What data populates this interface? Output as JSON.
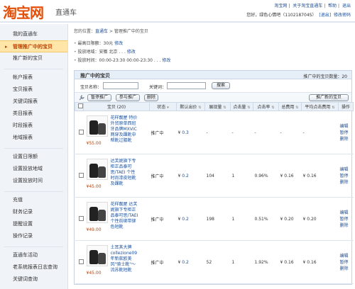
{
  "header": {
    "logo": "淘宝网",
    "logo_sub": "直通车",
    "top_links": [
      "淘宝网",
      "关于淘宝直通车",
      "帮助",
      "退出"
    ],
    "welcome": "您好，绿色心情吧（110218704S）",
    "exit_link": "[退出]",
    "modify_pwd": "修改密码"
  },
  "sidebar": {
    "items": [
      {
        "label": "我的直通车",
        "active": false
      },
      {
        "label": "管理推广中的宝贝",
        "active": true
      },
      {
        "label": "推广新的宝贝",
        "active": false
      },
      {
        "label": "帐户报表",
        "active": false
      },
      {
        "label": "宝贝报表",
        "active": false
      },
      {
        "label": "关键词报表",
        "active": false
      },
      {
        "label": "类目报表",
        "active": false
      },
      {
        "label": "时段报表",
        "active": false
      },
      {
        "label": "地域报表",
        "active": false
      },
      {
        "label": "设置日限额",
        "active": false
      },
      {
        "label": "设置投放地域",
        "active": false
      },
      {
        "label": "设置投放时间",
        "active": false
      },
      {
        "label": "充值",
        "active": false
      },
      {
        "label": "财务记录",
        "active": false
      },
      {
        "label": "提醒设置",
        "active": false
      },
      {
        "label": "操作记录",
        "active": false
      },
      {
        "label": "直通车活动",
        "active": false
      },
      {
        "label": "老系统报表日志查询",
        "active": false
      },
      {
        "label": "关键词查询",
        "active": false
      }
    ]
  },
  "breadcrumb": {
    "prefix": "您的位置：",
    "home": "直通车",
    "sep": " > ",
    "current": "管理推广中的宝贝"
  },
  "info": {
    "daily_limit": "最高日限额：30元",
    "daily_limit_edit": "修改",
    "region": "投放地域：安徽 北京 . . .",
    "region_edit": "修改",
    "time": "投放时间：00:00-23:30 00:00-23:30 . . .",
    "time_edit": "修改"
  },
  "panel": {
    "title": "推广中的宝贝",
    "count": "推广中的宝贝数量：20",
    "search": {
      "name_label": "宝贝名称：",
      "keyword_label": "关键词：",
      "search_button": "搜索"
    },
    "actions": {
      "pause": "暂停推广",
      "join": "参与推广",
      "delete": "删除",
      "promote_new": "推广新的宝贝"
    },
    "columns": [
      "宝贝",
      "状态",
      "默认出价",
      "展现量",
      "点击量",
      "点击率",
      "总费用",
      "平均点击费用",
      "操作"
    ],
    "baby_count_suffix": "(20)",
    "rows": [
      {
        "title": "花样靓屋 特价外贸原单西班牙品牌MXVIC两穿及踝靴中帮靴过膝靴",
        "price": "55.00",
        "status": "推广中",
        "bid": "0.3",
        "impressions": "-",
        "clicks": "-",
        "ctr": "-",
        "cost": "-",
        "avg_cpc": "-",
        "ops": [
          "编辑",
          "暂停",
          "删除"
        ]
      },
      {
        "title": "达芙妮旗下专柜正品泰可思/TAEI 个性时尚漆皮短靴及踝靴",
        "price": "45.00",
        "status": "推广中",
        "bid": "0.2",
        "impressions": "104",
        "clicks": "1",
        "ctr": "0.96%",
        "cost": "0.16",
        "avg_cpc": "0.16",
        "ops": [
          "编辑",
          "暂停",
          "删除"
        ]
      },
      {
        "title": "花样靓屋 达芙妮旗下专柜正品泰可思/TAEI 个性前绑带铆色短靴",
        "price": "49.00",
        "status": "推广中",
        "bid": "0.2",
        "impressions": "198",
        "clicks": "1",
        "ctr": "0.51%",
        "cost": "0.20",
        "avg_cpc": "0.20",
        "ops": [
          "编辑",
          "暂停",
          "删除"
        ]
      },
      {
        "title": "土耳其大牌 collezione09年新款欧美风\"骑士靴\"～流苏靴短靴",
        "price": "45.00",
        "status": "推广中",
        "bid": "0.2",
        "impressions": "52",
        "clicks": "1",
        "ctr": "1.92%",
        "cost": "0.16",
        "avg_cpc": "0.16",
        "ops": [
          "编辑",
          "暂停",
          "删除"
        ]
      }
    ]
  }
}
